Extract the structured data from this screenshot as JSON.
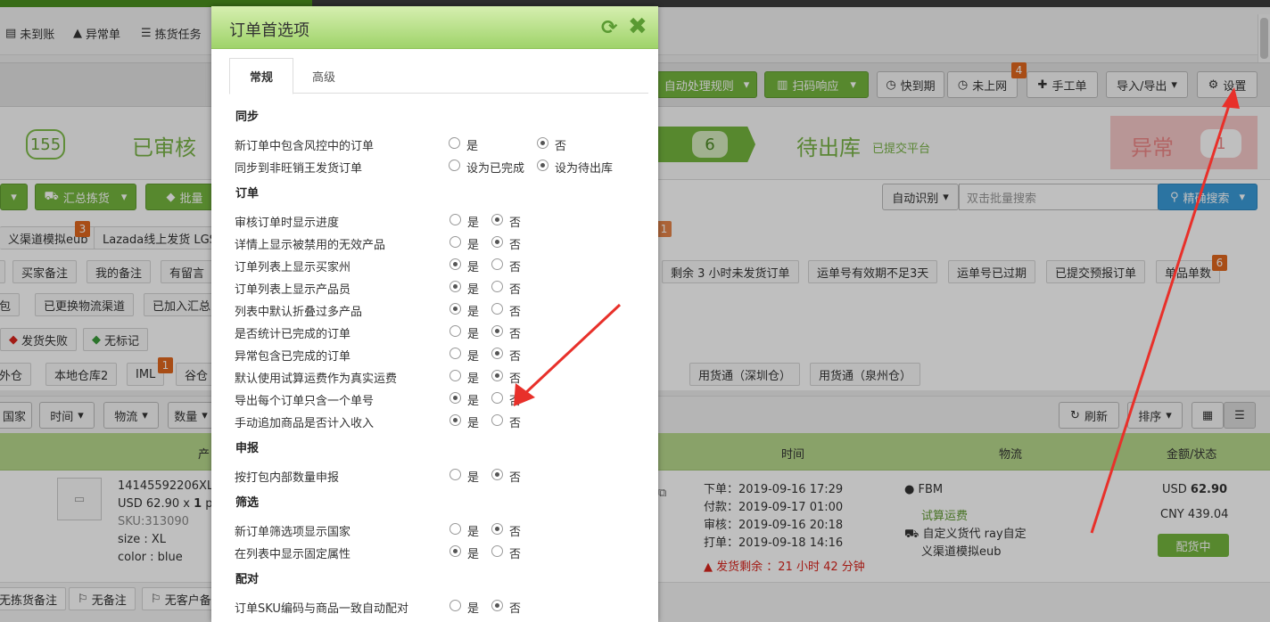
{
  "subnav": [
    "未到账",
    "异常单",
    "拣货任务"
  ],
  "toolbar": {
    "auto_rules": "自动处理规则",
    "scan": "扫码响应",
    "expiring": "快到期",
    "not_online": "未上网",
    "not_online_badge": "4",
    "manual": "手工单",
    "import_export": "导入/导出",
    "settings": "设置"
  },
  "steps": {
    "count1": "155",
    "reviewed": "已审核",
    "count2": "6",
    "pending_out": "待出库",
    "pending_out_sub": "已提交平台",
    "exception": "异常",
    "exception_count": "1"
  },
  "actions": {
    "summary_pick": "汇总拣货",
    "batch": "批量",
    "auto_detect": "自动识别",
    "search_placeholder": "双击批量搜索",
    "precise_search": "精确搜索"
  },
  "tags_row1": {
    "t1": "义渠道模拟eub",
    "t1_badge": "3",
    "t2": "Lazada线上发货 LGS",
    "badge_hidden": "1"
  },
  "tags_row2": [
    "买家备注",
    "我的备注",
    "有留言",
    "剩余 3 小时未发货订单",
    "运单号有效期不足3天",
    "运单号已过期",
    "已提交预报订单",
    "单品单数"
  ],
  "tags_row2_badge": "6",
  "tags_row3": [
    "包",
    "已更换物流渠道",
    "已加入汇总"
  ],
  "tags_row4": [
    "发货失败",
    "无标记"
  ],
  "tags_row5": [
    "外仓",
    "本地仓库2",
    "IML",
    "谷仓",
    "用货通（深圳仓）",
    "用货通（泉州仓）"
  ],
  "tags_row5_badge": "1",
  "sort": {
    "country": "国家",
    "time": "时间",
    "logistics": "物流",
    "qty": "数量",
    "refresh": "刷新",
    "sort": "排序"
  },
  "table_headers": [
    "产",
    "时间",
    "物流",
    "金额/状态"
  ],
  "order": {
    "sku_id": "14145592206XL",
    "price_line": "USD 62.90 x",
    "qty": "1",
    "price_suffix": "pi",
    "sku": "SKU:313090",
    "size": "size : XL",
    "color": "color : blue",
    "t_order_label": "下单：",
    "t_order": "2019-09-16 17:29",
    "t_pay_label": "付款：",
    "t_pay": "2019-09-17 01:00",
    "t_review_label": "审核：",
    "t_review": "2019-09-16 20:18",
    "t_print_label": "打单：",
    "t_print": "2019-09-18 14:16",
    "warn": "发货剩余 ：21 小时 42 分钟",
    "fbm": "FBM",
    "trial": "试算运费",
    "carrier": "自定义货代 ray自定",
    "carrier2": "义渠道模拟eub",
    "usd_cur": "USD",
    "usd": "62.90",
    "cny": "CNY 439.04",
    "status": "配货中"
  },
  "row2": [
    "无拣货备注",
    "无备注",
    "无客户备注"
  ],
  "modal": {
    "title": "订单首选项",
    "tabs": [
      "常规",
      "高级"
    ],
    "yes": "是",
    "no": "否",
    "sections": [
      {
        "title": "同步",
        "items": [
          {
            "label": "新订单中包含风控中的订单",
            "a": "是",
            "b": "否",
            "sel": "b"
          },
          {
            "label": "同步到非旺销王发货订单",
            "a": "设为已完成",
            "b": "设为待出库",
            "sel": "b"
          }
        ]
      },
      {
        "title": "订单",
        "items": [
          {
            "label": "审核订单时显示进度",
            "sel": "b"
          },
          {
            "label": "详情上显示被禁用的无效产品",
            "sel": "b"
          },
          {
            "label": "订单列表上显示买家州",
            "sel": "a"
          },
          {
            "label": "订单列表上显示产品员",
            "sel": "a"
          },
          {
            "label": "列表中默认折叠过多产品",
            "sel": "a"
          },
          {
            "label": "是否统计已完成的订单",
            "sel": "b"
          },
          {
            "label": "异常包含已完成的订单",
            "sel": "b"
          },
          {
            "label": "默认使用试算运费作为真实运费",
            "sel": "b"
          },
          {
            "label": "导出每个订单只含一个单号",
            "sel": "a"
          },
          {
            "label": "手动追加商品是否计入收入",
            "sel": "a"
          }
        ]
      },
      {
        "title": "申报",
        "items": [
          {
            "label": "按打包内部数量申报",
            "sel": "b"
          }
        ]
      },
      {
        "title": "筛选",
        "items": [
          {
            "label": "新订单筛选项显示国家",
            "sel": "b"
          },
          {
            "label": "在列表中显示固定属性",
            "sel": "a"
          }
        ]
      },
      {
        "title": "配对",
        "items": [
          {
            "label": "订单SKU编码与商品一致自动配对",
            "sel": "b"
          }
        ]
      }
    ]
  },
  "colors": {
    "green": "#75b63e",
    "header_green": "#b7d98c",
    "warn": "#d9251d",
    "badge": "#e0671e",
    "arrow": "#e8302a"
  }
}
